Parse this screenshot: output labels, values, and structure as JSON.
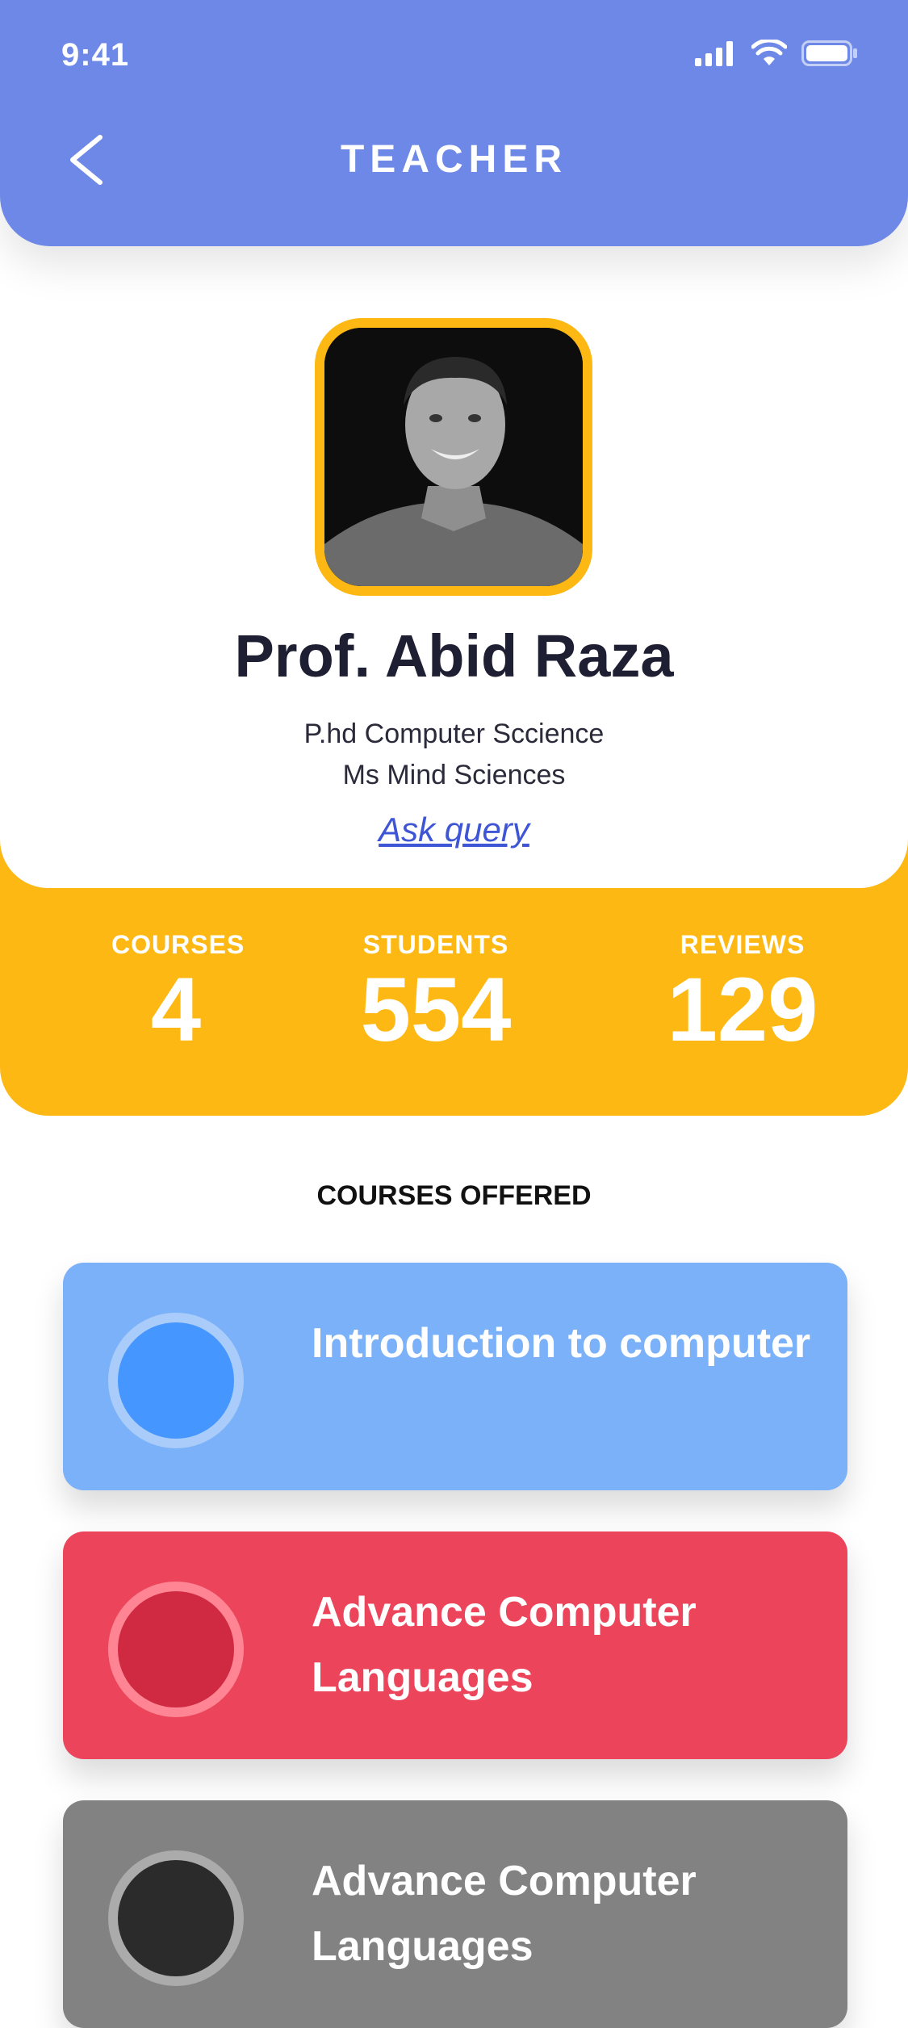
{
  "status_bar": {
    "time": "9:41"
  },
  "header": {
    "title": "TEACHER"
  },
  "profile": {
    "name": "Prof. Abid Raza",
    "degrees": [
      "P.hd Computer Sccience",
      "Ms Mind Sciences"
    ],
    "ask_query": "Ask query"
  },
  "stats": [
    {
      "label": "COURSES",
      "value": "4"
    },
    {
      "label": "STUDENTS",
      "value": "554"
    },
    {
      "label": "REVIEWS",
      "value": "129"
    }
  ],
  "courses_section": {
    "title": "COURSES OFFERED"
  },
  "courses": [
    {
      "title": "Introduction to computer",
      "color": "#7BB1F9",
      "dot_fill": "#4596FF",
      "dot_ring": "#A9CCFA"
    },
    {
      "title": "Advance Computer Languages",
      "color": "#EC455B",
      "dot_fill": "#D02A43",
      "dot_ring": "#FF8594"
    },
    {
      "title": "Advance Computer Languages",
      "color": "#828282",
      "dot_fill": "#2B2B2B",
      "dot_ring": "#ABABAB"
    }
  ],
  "colors": {
    "header": "#6D88E7",
    "accent": "#FDB813",
    "link": "#3E55D6"
  }
}
